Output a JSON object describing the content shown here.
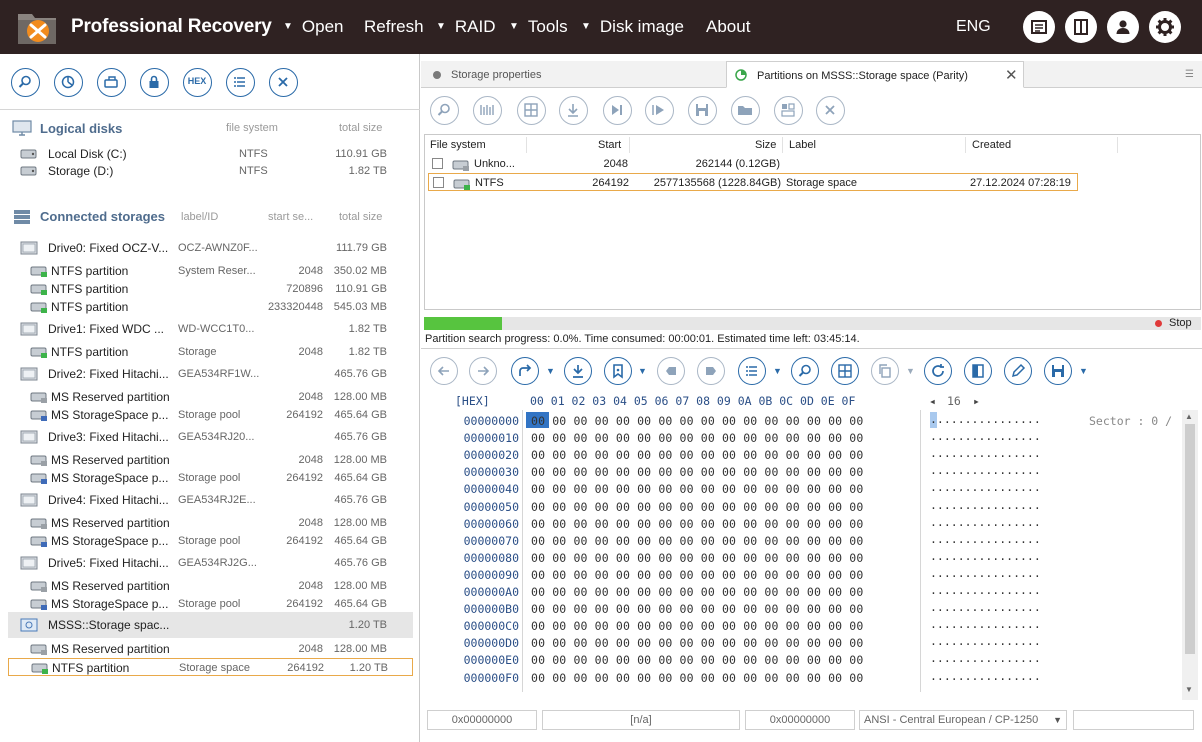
{
  "app": {
    "title": "Professional Recovery",
    "menu": [
      {
        "label": "Open",
        "has_caret": true
      },
      {
        "label": "Refresh",
        "has_caret": false
      },
      {
        "label": "RAID",
        "has_caret": true
      },
      {
        "label": "Tools",
        "has_caret": true
      },
      {
        "label": "Disk image",
        "has_caret": true
      },
      {
        "label": "About",
        "has_caret": false
      }
    ],
    "language": "ENG",
    "header_icons": [
      "news-icon",
      "layout-icon",
      "user-icon",
      "gear-icon"
    ]
  },
  "left_toolbar": {
    "buttons": [
      "search-icon",
      "scan-icon",
      "image-icon",
      "lock-icon",
      "hex-icon",
      "list-icon",
      "close-icon"
    ],
    "hex_label": "HEX"
  },
  "logical_disks": {
    "title": "Logical disks",
    "col_fs": "file system",
    "col_size": "total size",
    "items": [
      {
        "name": "Local Disk (C:)",
        "fs": "NTFS",
        "size": "110.91 GB"
      },
      {
        "name": "Storage (D:)",
        "fs": "NTFS",
        "size": "1.82 TB"
      }
    ]
  },
  "connected_storages": {
    "title": "Connected storages",
    "col_label": "label/ID",
    "col_start": "start se...",
    "col_size": "total size",
    "rows": [
      {
        "type": "drive",
        "name": "Drive0: Fixed OCZ-V...",
        "label": "OCZ-AWNZ0F...",
        "start": "",
        "size": "111.79 GB"
      },
      {
        "type": "part",
        "name": "NTFS partition",
        "label": "System Reser...",
        "start": "2048",
        "size": "350.02 MB"
      },
      {
        "type": "part",
        "name": "NTFS partition",
        "label": "",
        "start": "720896",
        "size": "110.91 GB"
      },
      {
        "type": "part",
        "name": "NTFS partition",
        "label": "",
        "start": "233320448",
        "size": "545.03 MB"
      },
      {
        "type": "drive",
        "name": "Drive1: Fixed WDC ...",
        "label": "WD-WCC1T0...",
        "start": "",
        "size": "1.82 TB"
      },
      {
        "type": "part",
        "name": "NTFS partition",
        "label": "Storage",
        "start": "2048",
        "size": "1.82 TB"
      },
      {
        "type": "drive",
        "name": "Drive2: Fixed Hitachi...",
        "label": "GEA534RF1W...",
        "start": "",
        "size": "465.76 GB"
      },
      {
        "type": "part-gray",
        "name": "MS Reserved partition",
        "label": "",
        "start": "2048",
        "size": "128.00 MB"
      },
      {
        "type": "pool",
        "name": "MS StorageSpace p...",
        "label": "Storage pool",
        "start": "264192",
        "size": "465.64 GB"
      },
      {
        "type": "drive",
        "name": "Drive3: Fixed Hitachi...",
        "label": "GEA534RJ20...",
        "start": "",
        "size": "465.76 GB"
      },
      {
        "type": "part-gray",
        "name": "MS Reserved partition",
        "label": "",
        "start": "2048",
        "size": "128.00 MB"
      },
      {
        "type": "pool",
        "name": "MS StorageSpace p...",
        "label": "Storage pool",
        "start": "264192",
        "size": "465.64 GB"
      },
      {
        "type": "drive",
        "name": "Drive4: Fixed Hitachi...",
        "label": "GEA534RJ2E...",
        "start": "",
        "size": "465.76 GB"
      },
      {
        "type": "part-gray",
        "name": "MS Reserved partition",
        "label": "",
        "start": "2048",
        "size": "128.00 MB"
      },
      {
        "type": "pool",
        "name": "MS StorageSpace p...",
        "label": "Storage pool",
        "start": "264192",
        "size": "465.64 GB"
      },
      {
        "type": "drive",
        "name": "Drive5: Fixed Hitachi...",
        "label": "GEA534RJ2G...",
        "start": "",
        "size": "465.76 GB"
      },
      {
        "type": "part-gray",
        "name": "MS Reserved partition",
        "label": "",
        "start": "2048",
        "size": "128.00 MB"
      },
      {
        "type": "pool",
        "name": "MS StorageSpace p...",
        "label": "Storage pool",
        "start": "264192",
        "size": "465.64 GB"
      },
      {
        "type": "space",
        "name": "MSSS::Storage spac...",
        "label": "",
        "start": "",
        "size": "1.20 TB",
        "selected": true
      },
      {
        "type": "part-gray",
        "name": "MS Reserved partition",
        "label": "",
        "start": "2048",
        "size": "128.00 MB"
      },
      {
        "type": "part",
        "name": "NTFS partition",
        "label": "Storage space",
        "start": "264192",
        "size": "1.20 TB",
        "highlight": true
      }
    ]
  },
  "tabs": [
    {
      "label": "Storage properties",
      "active": false
    },
    {
      "label": "Partitions on MSSS::Storage space (Parity)",
      "active": true
    }
  ],
  "right_toolbar": [
    "search-icon",
    "mft-icon",
    "grid-icon",
    "import-icon",
    "skip-icon",
    "play-icon",
    "save-icon",
    "folder-icon",
    "compare-icon",
    "close-icon"
  ],
  "partitions": {
    "columns": [
      "File system",
      "Start",
      "Size",
      "Label",
      "Created"
    ],
    "rows": [
      {
        "fs": "Unkno...",
        "start": "2048",
        "size": "262144 (0.12GB)",
        "label": "",
        "created": ""
      },
      {
        "fs": "NTFS",
        "start": "264192",
        "size": "2577135568 (1228.84GB)",
        "label": "Storage space",
        "created": "27.12.2024 07:28:19",
        "highlight": true
      }
    ]
  },
  "progress": {
    "fraction": 0.1,
    "stop_label": "Stop",
    "text": "Partition search progress: 0.0%. Time consumed: 00:00:01. Estimated time left: 03:45:14."
  },
  "hex_toolbar": [
    "arrow-left-icon",
    "arrow-right-icon",
    "redo-icon",
    "download-icon",
    "bookmark-icon",
    "prev-mark-icon",
    "next-mark-icon",
    "list-icon",
    "search-icon",
    "grid-icon",
    "copy-icon",
    "refresh-icon",
    "split-icon",
    "edit-icon",
    "save-icon"
  ],
  "hex_view": {
    "header_label": "[HEX]",
    "columns": "00 01 02 03 04 05 06 07 08 09 0A 0B 0C 0D 0E 0F",
    "width_label": "16",
    "offsets": [
      "00000000",
      "00000010",
      "00000020",
      "00000030",
      "00000040",
      "00000050",
      "00000060",
      "00000070",
      "00000080",
      "00000090",
      "000000A0",
      "000000B0",
      "000000C0",
      "000000D0",
      "000000E0",
      "000000F0"
    ],
    "row_bytes": "00 00 00 00 00 00 00 00 00 00 00 00 00 00 00 00",
    "row_ascii": "................",
    "selected_byte": "00",
    "sector_label": "Sector : 0 /"
  },
  "statusbar": {
    "offset": "0x00000000",
    "value": "[n/a]",
    "position": "0x00000000",
    "encoding": "ANSI - Central European / CP-1250",
    "extra": ""
  }
}
